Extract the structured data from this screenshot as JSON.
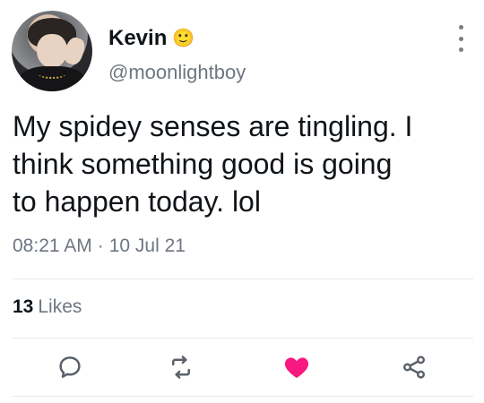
{
  "user": {
    "display_name": "Kevin",
    "name_emoji": "🙂",
    "handle": "@moonlightboy"
  },
  "tweet": {
    "text": "My spidey senses are tingling. I\nthink something good is going\nto happen today. lol",
    "time": "08:21 AM",
    "separator": "·",
    "date": "10 Jul 21"
  },
  "stats": {
    "likes_count": "13",
    "likes_label": "Likes"
  },
  "actions": {
    "reply_icon": "reply-icon",
    "retweet_icon": "retweet-icon",
    "like_icon": "heart-icon",
    "share_icon": "share-icon",
    "liked": true,
    "like_color": "#f91880"
  },
  "colors": {
    "text": "#0f1419",
    "secondary": "#6e7681",
    "divider": "#e6e9ec"
  }
}
